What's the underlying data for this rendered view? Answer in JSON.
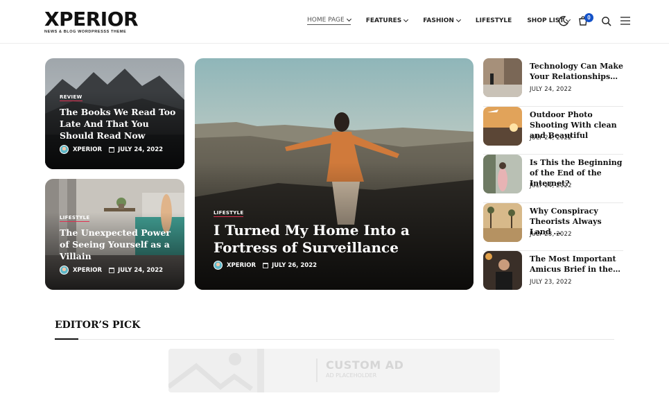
{
  "header": {
    "logo": {
      "title": "XPERIOR",
      "tagline": "NEWS & BLOG WORDPRESSS THEME"
    },
    "nav": [
      {
        "label": "HOME PAGE",
        "has_dropdown": true,
        "active": true
      },
      {
        "label": "FEATURES",
        "has_dropdown": true
      },
      {
        "label": "FASHION",
        "has_dropdown": true
      },
      {
        "label": "LIFESTYLE",
        "has_dropdown": false
      },
      {
        "label": "SHOP LIST",
        "has_dropdown": true
      }
    ],
    "cart_count": "0",
    "icons": [
      "moon-icon",
      "cart-icon",
      "search-icon",
      "menu-icon"
    ],
    "accent_color": "#1452c8"
  },
  "featured_left": [
    {
      "category": "REVIEW",
      "title": "The Books We Read Too Late And That You Should Read Now",
      "author": "XPERIOR",
      "date": "JULY 24, 2022"
    },
    {
      "category": "LIFESTYLE",
      "title": "The Unexpected Power of Seeing Yourself as a Villain",
      "author": "XPERIOR",
      "date": "JULY 24, 2022"
    }
  ],
  "featured_main": {
    "category": "LIFESTYLE",
    "title": "I Turned My Home Into a Fortress of Surveillance",
    "author": "XPERIOR",
    "date": "JULY 26, 2022"
  },
  "side_list": [
    {
      "title": "Technology Can Make Your Relationships…",
      "date": "JULY 24, 2022"
    },
    {
      "title": "Outdoor Photo Shooting With clean and Beautiful",
      "date": "JULY 24, 2022"
    },
    {
      "title": "Is This the Beginning of the End of the Internet?",
      "date": "JULY 24, 2022"
    },
    {
      "title": "Why Conspiracy Theorists Always Land …",
      "date": "JULY 23, 2022"
    },
    {
      "title": "The Most Important Amicus Brief in the…",
      "date": "JULY 23, 2022"
    }
  ],
  "editors_pick": {
    "heading": "EDITOR’S PICK"
  },
  "ad": {
    "title": "CUSTOM AD",
    "subtitle": "AD PLACEHOLDER"
  },
  "category_underline_color": "#e03050"
}
